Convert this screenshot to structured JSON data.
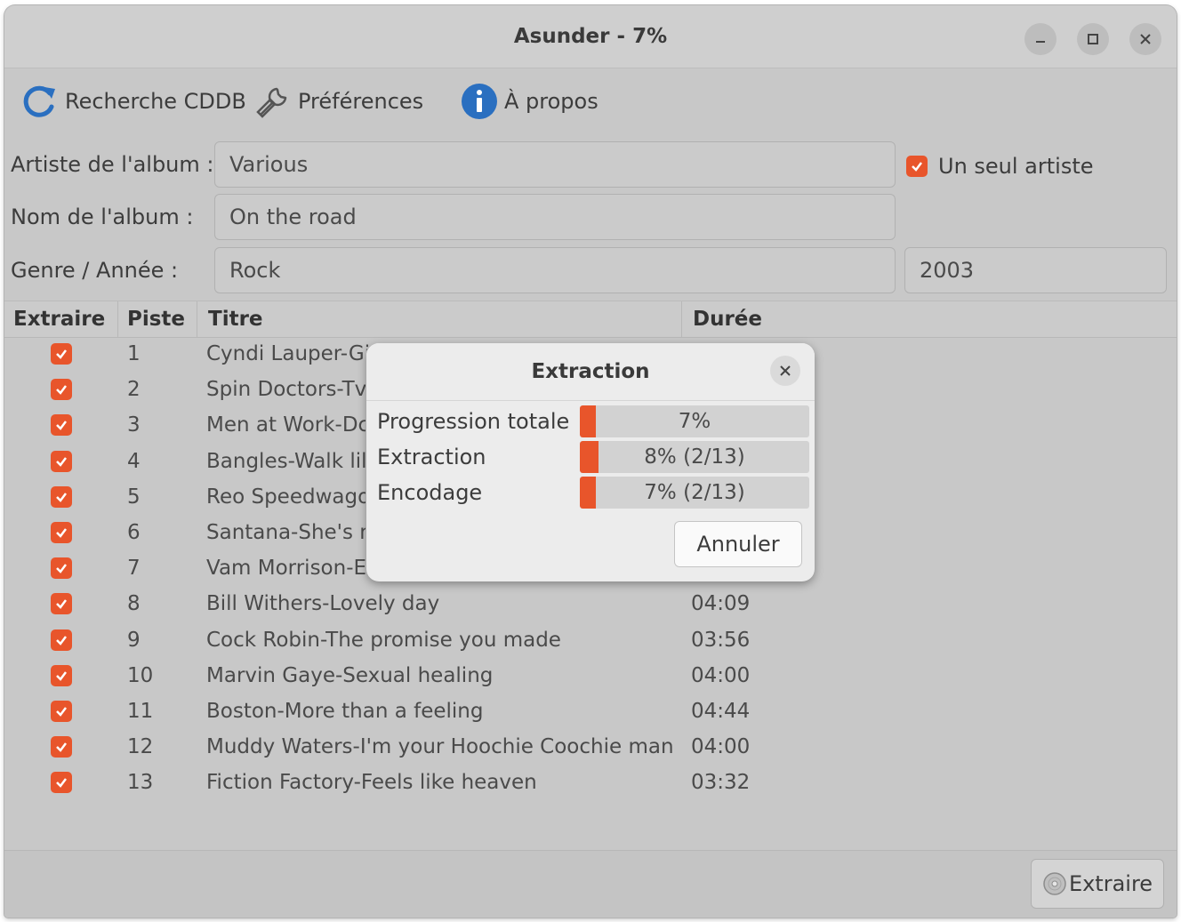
{
  "window": {
    "title": "Asunder - 7%"
  },
  "toolbar": {
    "cddb": "Recherche CDDB",
    "preferences": "Préférences",
    "about": "À propos"
  },
  "form": {
    "artist_label": "Artiste de l'album :",
    "artist_value": "Various",
    "single_artist_label": "Un seul artiste",
    "single_artist_checked": true,
    "album_label": "Nom de l'album :",
    "album_value": "On the road",
    "genre_year_label": "Genre / Année :",
    "genre_value": "Rock",
    "year_value": "2003"
  },
  "table": {
    "headers": [
      "Extraire",
      "Piste",
      "Titre",
      "Durée"
    ],
    "rows": [
      {
        "checked": true,
        "track": "1",
        "title": "Cyndi Lauper-Gi",
        "duration": ""
      },
      {
        "checked": true,
        "track": "2",
        "title": "Spin Doctors-Tv",
        "duration": ""
      },
      {
        "checked": true,
        "track": "3",
        "title": "Men at Work-Dc",
        "duration": ""
      },
      {
        "checked": true,
        "track": "4",
        "title": "Bangles-Walk lil",
        "duration": ""
      },
      {
        "checked": true,
        "track": "5",
        "title": "Reo Speedwago",
        "duration": ""
      },
      {
        "checked": true,
        "track": "6",
        "title": "Santana-She's n",
        "duration": ""
      },
      {
        "checked": true,
        "track": "7",
        "title": "Vam Morrison-E",
        "duration": ""
      },
      {
        "checked": true,
        "track": "8",
        "title": "Bill Withers-Lovely day",
        "duration": "04:09"
      },
      {
        "checked": true,
        "track": "9",
        "title": "Cock Robin-The promise you made",
        "duration": "03:56"
      },
      {
        "checked": true,
        "track": "10",
        "title": "Marvin Gaye-Sexual healing",
        "duration": "04:00"
      },
      {
        "checked": true,
        "track": "11",
        "title": "Boston-More than a feeling",
        "duration": "04:44"
      },
      {
        "checked": true,
        "track": "12",
        "title": "Muddy Waters-I'm your Hoochie Coochie man",
        "duration": "04:00"
      },
      {
        "checked": true,
        "track": "13",
        "title": "Fiction Factory-Feels like heaven",
        "duration": "03:32"
      }
    ]
  },
  "bottom": {
    "extract_button": "Extraire"
  },
  "dialog": {
    "title": "Extraction",
    "progress": [
      {
        "label": "Progression totale",
        "text": "7%",
        "percent": 7
      },
      {
        "label": "Extraction",
        "text": "8% (2/13)",
        "percent": 8
      },
      {
        "label": "Encodage",
        "text": "7% (2/13)",
        "percent": 7
      }
    ],
    "cancel_button": "Annuler"
  },
  "colors": {
    "accent": "#e8552b",
    "about_icon": "#2a6fc0",
    "refresh_icon": "#2a6fc0"
  },
  "icons": {
    "cddb": "refresh-icon",
    "preferences": "wrench-icon",
    "about": "info-icon",
    "extract": "cd-icon"
  }
}
